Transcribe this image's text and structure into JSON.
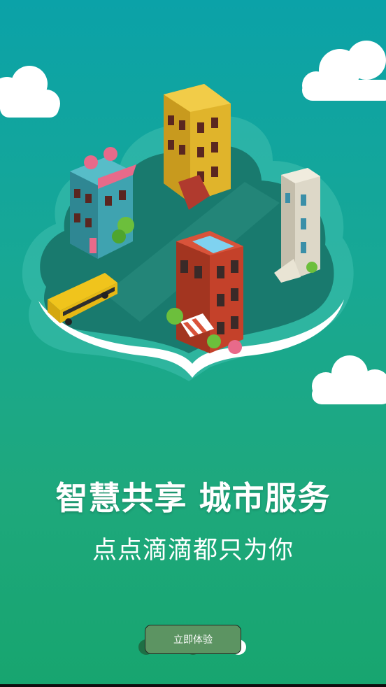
{
  "hero": {
    "illustration_icon": "city-cloud-illustration-icon",
    "clouds": [
      "cloud-icon",
      "cloud-icon",
      "cloud-icon"
    ]
  },
  "text": {
    "headline": "智慧共享 城市服务",
    "subline": "点点滴滴都只为你"
  },
  "pager": {
    "page_count": 3,
    "active_index": 2
  },
  "start_button": {
    "label": "立即体验"
  },
  "colors": {
    "background_top": "#0ba2a8",
    "background_bottom": "#17a56f",
    "button": "#5c9462",
    "dot_inactive": "#1e6f45",
    "dot_active": "#ffffff"
  }
}
